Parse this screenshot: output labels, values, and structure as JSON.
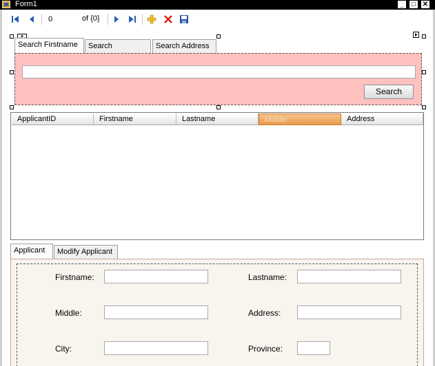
{
  "window": {
    "title": "Form1"
  },
  "navigator": {
    "position": "0",
    "count_text": "of {0}"
  },
  "search_tabs": [
    {
      "label": "Search Firstname"
    },
    {
      "label": "Search Lastname"
    },
    {
      "label": "Search Address"
    }
  ],
  "search": {
    "input_value": "",
    "button_label": "Search"
  },
  "grid": {
    "columns": [
      "ApplicantID",
      "Firstname",
      "Lastname",
      "Middle",
      "Address"
    ],
    "selected_column": "Middle",
    "rows": []
  },
  "detail_tabs": [
    {
      "label": "Applicant"
    },
    {
      "label": "Modify Applicant"
    }
  ],
  "fields": {
    "firstname_label": "Firstname:",
    "lastname_label": "Lastname:",
    "middle_label": "Middle:",
    "address_label": "Address:",
    "city_label": "City:",
    "province_label": "Province:"
  },
  "colors": {
    "search_panel_bg": "#ffc0c0",
    "selected_header": "#e99a4c",
    "detail_panel_bg": "#f8f4ee"
  }
}
